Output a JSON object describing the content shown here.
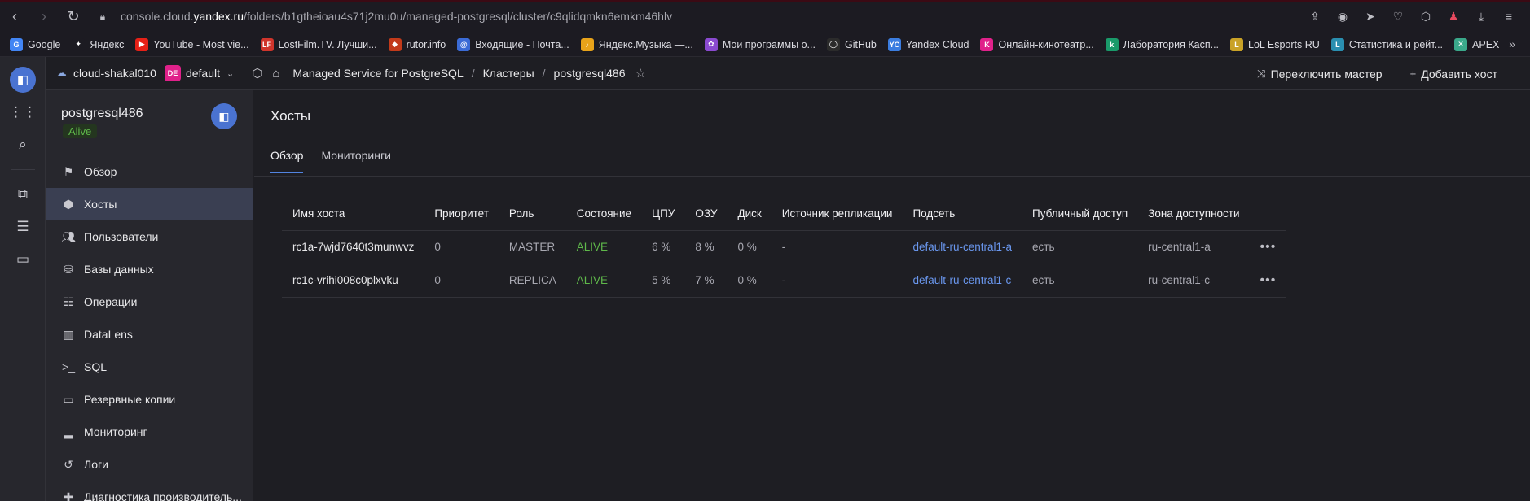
{
  "browser": {
    "url_prefix": "console.cloud.",
    "url_domain": "yandex.ru",
    "url_path": "/folders/b1gtheioau4s71j2mu0u/managed-postgresql/cluster/c9qlidqmkn6emkm46hlv"
  },
  "bookmarks": [
    {
      "label": "Google",
      "icon": "google-icon",
      "color": "#4285f4"
    },
    {
      "label": "Яндекс",
      "icon": "yandex-star-icon",
      "color": "#1c1b22"
    },
    {
      "label": "YouTube - Most vie...",
      "icon": "youtube-icon",
      "color": "#e62117"
    },
    {
      "label": "LostFilm.TV. Лучши...",
      "icon": "lostfilm-icon",
      "color": "#d0352c"
    },
    {
      "label": "rutor.info",
      "icon": "rutor-icon",
      "color": "#c23a1a"
    },
    {
      "label": "Входящие - Почта...",
      "icon": "mail-icon",
      "color": "#3b6bd6"
    },
    {
      "label": "Яндекс.Музыка —...",
      "icon": "music-icon",
      "color": "#e8a31a"
    },
    {
      "label": "Мои программы о...",
      "icon": "programs-icon",
      "color": "#8a4ad0"
    },
    {
      "label": "GitHub",
      "icon": "github-icon",
      "color": "#2b2b2b"
    },
    {
      "label": "Yandex Cloud",
      "icon": "yandex-cloud-icon",
      "color": "#3b7de0"
    },
    {
      "label": "Онлайн-кинотеатр...",
      "icon": "kinopoisk-icon",
      "color": "#e0218a"
    },
    {
      "label": "Лаборатория Касп...",
      "icon": "kaspersky-icon",
      "color": "#1a9a6a"
    },
    {
      "label": "LoL Esports RU",
      "icon": "lol-icon",
      "color": "#c9a227"
    },
    {
      "label": "Статистика и рейт...",
      "icon": "stats-icon",
      "color": "#2a8fb0"
    },
    {
      "label": "APEX",
      "icon": "apex-icon",
      "color": "#3aa88a"
    }
  ],
  "header": {
    "cloud": "cloud-shakal010",
    "folder_badge": "DE",
    "folder": "default",
    "crumbs": [
      "Managed Service for PostgreSQL",
      "Кластеры",
      "postgresql486"
    ],
    "switch_master": "Переключить мастер",
    "add_host": "Добавить хост"
  },
  "cluster": {
    "name": "postgresql486",
    "status": "Alive"
  },
  "sidebar": {
    "items": [
      {
        "label": "Обзор",
        "icon": "flag-icon"
      },
      {
        "label": "Хосты",
        "icon": "cube-icon"
      },
      {
        "label": "Пользователи",
        "icon": "users-icon"
      },
      {
        "label": "Базы данных",
        "icon": "database-icon"
      },
      {
        "label": "Операции",
        "icon": "list-icon"
      },
      {
        "label": "DataLens",
        "icon": "chart-icon"
      },
      {
        "label": "SQL",
        "icon": "terminal-icon"
      },
      {
        "label": "Резервные копии",
        "icon": "archive-icon"
      },
      {
        "label": "Мониторинг",
        "icon": "monitoring-icon"
      },
      {
        "label": "Логи",
        "icon": "history-icon"
      },
      {
        "label": "Диагностика производитель...",
        "icon": "diagnostics-icon"
      }
    ]
  },
  "main": {
    "title": "Хосты",
    "tabs": [
      "Обзор",
      "Мониторинги"
    ],
    "columns": [
      "Имя хоста",
      "Приоритет",
      "Роль",
      "Состояние",
      "ЦПУ",
      "ОЗУ",
      "Диск",
      "Источник репликации",
      "Подсеть",
      "Публичный доступ",
      "Зона доступности"
    ],
    "rows": [
      [
        "rc1a-7wjd7640t3munwvz",
        "0",
        "MASTER",
        "ALIVE",
        "6 %",
        "8 %",
        "0 %",
        "-",
        "default-ru-central1-a",
        "есть",
        "ru-central1-a"
      ],
      [
        "rc1c-vrihi008c0plxvku",
        "0",
        "REPLICA",
        "ALIVE",
        "5 %",
        "7 %",
        "0 %",
        "-",
        "default-ru-central1-c",
        "есть",
        "ru-central1-c"
      ]
    ]
  }
}
